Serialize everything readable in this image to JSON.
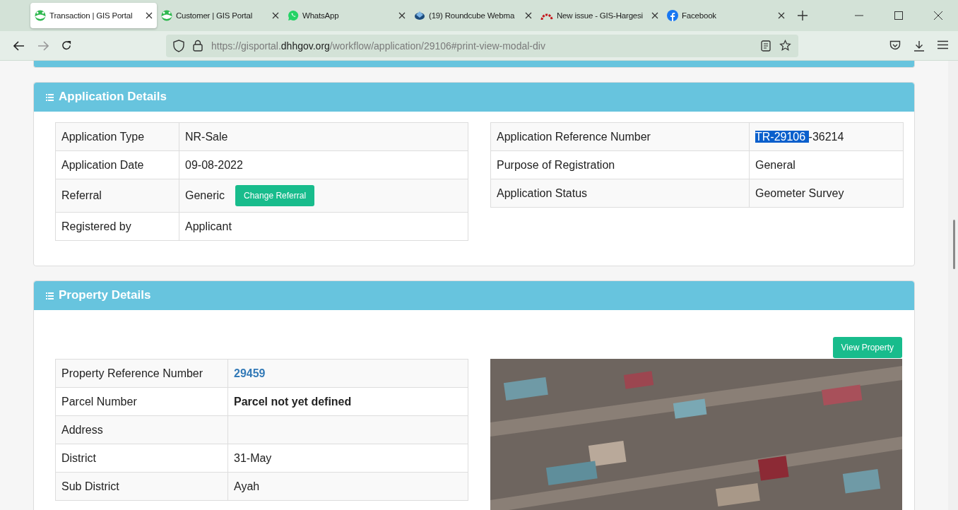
{
  "browser": {
    "tabs": [
      {
        "title": "Transaction | GIS Portal",
        "selected": true
      },
      {
        "title": "Customer | GIS Portal",
        "selected": false
      },
      {
        "title": "WhatsApp",
        "selected": false
      },
      {
        "title": "(19) Roundcube Webma",
        "selected": false
      },
      {
        "title": "New issue - GIS-Hargesi",
        "selected": false
      },
      {
        "title": "Facebook",
        "selected": false
      }
    ],
    "url": {
      "prefix": "https://gisportal.",
      "domain": "dhhgov.org",
      "path": "/workflow/application/29106#print-view-modal-div"
    }
  },
  "application_details": {
    "title": "Application Details",
    "left_rows": [
      {
        "label": "Application Type",
        "value": "NR-Sale"
      },
      {
        "label": "Application Date",
        "value": "09-08-2022"
      },
      {
        "label": "Referral",
        "value": "Generic",
        "button": "Change Referral"
      },
      {
        "label": "Registered by",
        "value": "Applicant"
      }
    ],
    "right_rows": [
      {
        "label": "Application Reference Number",
        "value_parts": [
          {
            "text": "TR-29106 ",
            "highlighted": true
          },
          {
            "text": "-36214",
            "highlighted": false
          }
        ]
      },
      {
        "label": "Purpose of Registration",
        "value": "General"
      },
      {
        "label": "Application Status",
        "value": "Geometer Survey"
      }
    ]
  },
  "property_details": {
    "title": "Property Details",
    "button": "View Property",
    "rows": [
      {
        "label": "Property Reference Number",
        "value": "29459",
        "kind": "link"
      },
      {
        "label": "Parcel Number",
        "value": "Parcel not yet defined",
        "kind": "bold"
      },
      {
        "label": "Address",
        "kind": "plain"
      },
      {
        "label": "District",
        "value": "31-May",
        "kind": "plain"
      },
      {
        "label": "Sub District",
        "value": "Ayah",
        "kind": "plain"
      }
    ]
  }
}
